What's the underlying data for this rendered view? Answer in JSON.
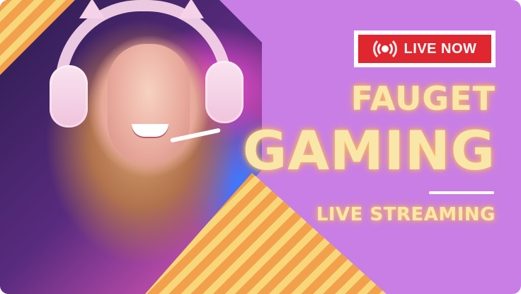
{
  "badge": {
    "label": "LIVE NOW",
    "icon": "live-broadcast-icon",
    "color": "#e0262f"
  },
  "brand": {
    "line1": "FAUGET",
    "line2": "GAMING"
  },
  "tagline": "LIVE STREAMING",
  "colors": {
    "background": "#c97ee6",
    "glow_text": "#f9e7a9",
    "stripe_orange": "#f3a04c",
    "stripe_yellow": "#f7d77a"
  }
}
